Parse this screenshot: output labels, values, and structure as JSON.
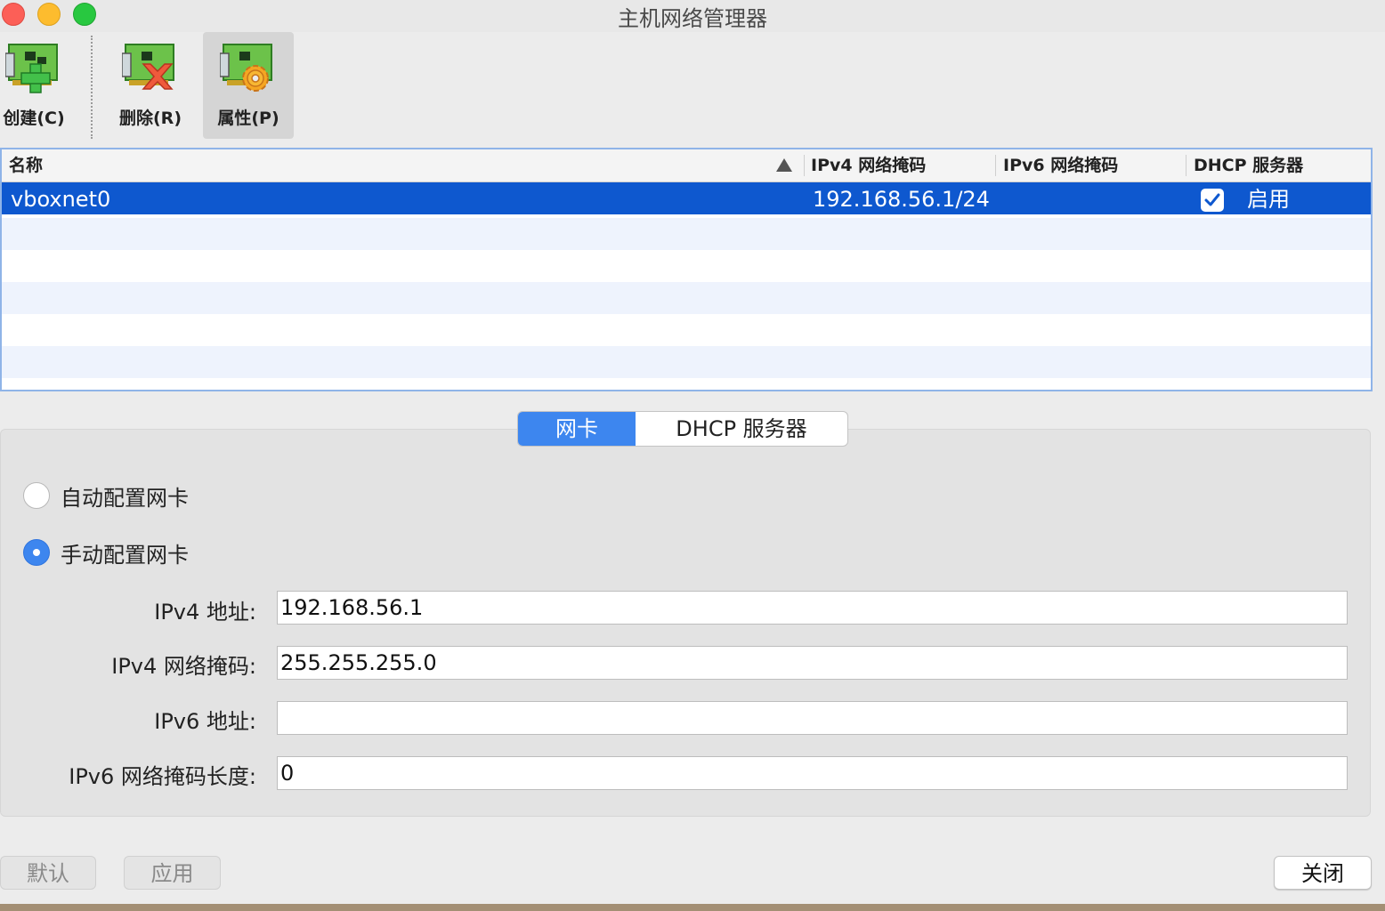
{
  "window": {
    "title": "主机网络管理器"
  },
  "toolbar": {
    "create_label": "创建(C)",
    "delete_label": "删除(R)",
    "properties_label": "属性(P)"
  },
  "table": {
    "columns": [
      "名称",
      "IPv4 网络掩码",
      "IPv6 网络掩码",
      "DHCP 服务器"
    ],
    "rows": [
      {
        "name": "vboxnet0",
        "ipv4": "192.168.56.1/24",
        "ipv6": "",
        "dhcp_checked": true,
        "dhcp": "启用"
      }
    ]
  },
  "tabs": {
    "nic": "网卡",
    "dhcp": "DHCP 服务器",
    "active": "nic"
  },
  "adapter": {
    "auto_label": "自动配置网卡",
    "manual_label": "手动配置网卡",
    "mode": "manual",
    "ipv4_address_label": "IPv4 地址:",
    "ipv4_address": "192.168.56.1",
    "ipv4_mask_label": "IPv4 网络掩码:",
    "ipv4_mask": "255.255.255.0",
    "ipv6_address_label": "IPv6 地址:",
    "ipv6_address": "",
    "ipv6_prefix_label": "IPv6 网络掩码长度:",
    "ipv6_prefix": "0"
  },
  "buttons": {
    "default": "默认",
    "apply": "应用",
    "close": "关闭"
  },
  "colors": {
    "selection": "#0e58cf",
    "accent": "#3d86ef",
    "row_alt": "#eef3fd"
  },
  "icons": [
    "nic-add-icon",
    "nic-remove-icon",
    "nic-properties-icon",
    "sort-ascending-icon",
    "checkmark-icon"
  ]
}
